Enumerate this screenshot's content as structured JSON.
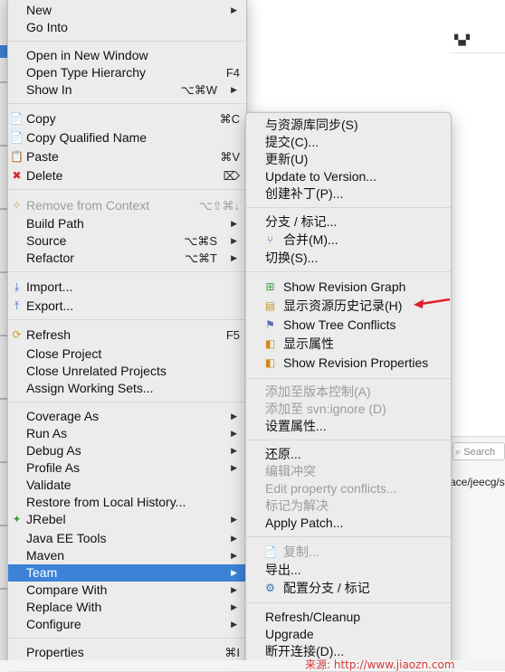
{
  "main_menu": {
    "new": "New",
    "go_into": "Go Into",
    "open_new_window": "Open in New Window",
    "open_type_hierarchy": "Open Type Hierarchy",
    "open_type_hierarchy_sc": "F4",
    "show_in": "Show In",
    "show_in_sc": "⌥⌘W",
    "copy": "Copy",
    "copy_sc": "⌘C",
    "copy_qualified": "Copy Qualified Name",
    "paste": "Paste",
    "paste_sc": "⌘V",
    "delete": "Delete",
    "delete_sc": "⌦",
    "remove_context": "Remove from Context",
    "remove_context_sc": "⌥⇧⌘↓",
    "build_path": "Build Path",
    "source": "Source",
    "source_sc": "⌥⌘S",
    "refactor": "Refactor",
    "refactor_sc": "⌥⌘T",
    "import": "Import...",
    "export": "Export...",
    "refresh": "Refresh",
    "refresh_sc": "F5",
    "close_project": "Close Project",
    "close_unrelated": "Close Unrelated Projects",
    "assign_working_sets": "Assign Working Sets...",
    "coverage_as": "Coverage As",
    "run_as": "Run As",
    "debug_as": "Debug As",
    "profile_as": "Profile As",
    "validate": "Validate",
    "restore_local_history": "Restore from Local History...",
    "jrebel": "JRebel",
    "java_ee_tools": "Java EE Tools",
    "maven": "Maven",
    "team": "Team",
    "compare_with": "Compare With",
    "replace_with": "Replace With",
    "configure": "Configure",
    "properties": "Properties",
    "properties_sc": "⌘I"
  },
  "team_submenu": {
    "sync_repo": "与资源库同步(S)",
    "commit": "提交(C)...",
    "update": "更新(U)",
    "update_to_version": "Update to Version...",
    "create_patch": "创建补丁(P)...",
    "branch_tag": "分支 / 标记...",
    "merge": "合并(M)...",
    "switch": "切换(S)...",
    "show_revision_graph": "Show Revision Graph",
    "show_history": "显示资源历史记录(H)",
    "show_tree_conflicts": "Show Tree Conflicts",
    "show_properties": "显示属性",
    "show_revision_properties": "Show Revision Properties",
    "add_to_version_control": "添加至版本控制(A)",
    "add_to_svn_ignore": "添加至 svn:ignore (D)",
    "set_property": "设置属性...",
    "revert": "还原...",
    "edit_conflicts": "编辑冲突",
    "edit_property_conflicts": "Edit property conflicts...",
    "mark_resolved": "标记为解决",
    "apply_patch": "Apply Patch...",
    "copy": "复制...",
    "export": "导出...",
    "configure_branches": "配置分支 / 标记",
    "refresh_cleanup": "Refresh/Cleanup",
    "upgrade": "Upgrade",
    "disconnect": "断开连接(D)..."
  },
  "right_panel": {
    "search_placeholder": "Search",
    "path_text": "ace/jeecg/s"
  },
  "watermark": "来源: http://www.jiaozn.com",
  "colors": {
    "selection": "#3c83d8",
    "menu_bg": "#ececec",
    "annotation_arrow": "#e0202a"
  }
}
